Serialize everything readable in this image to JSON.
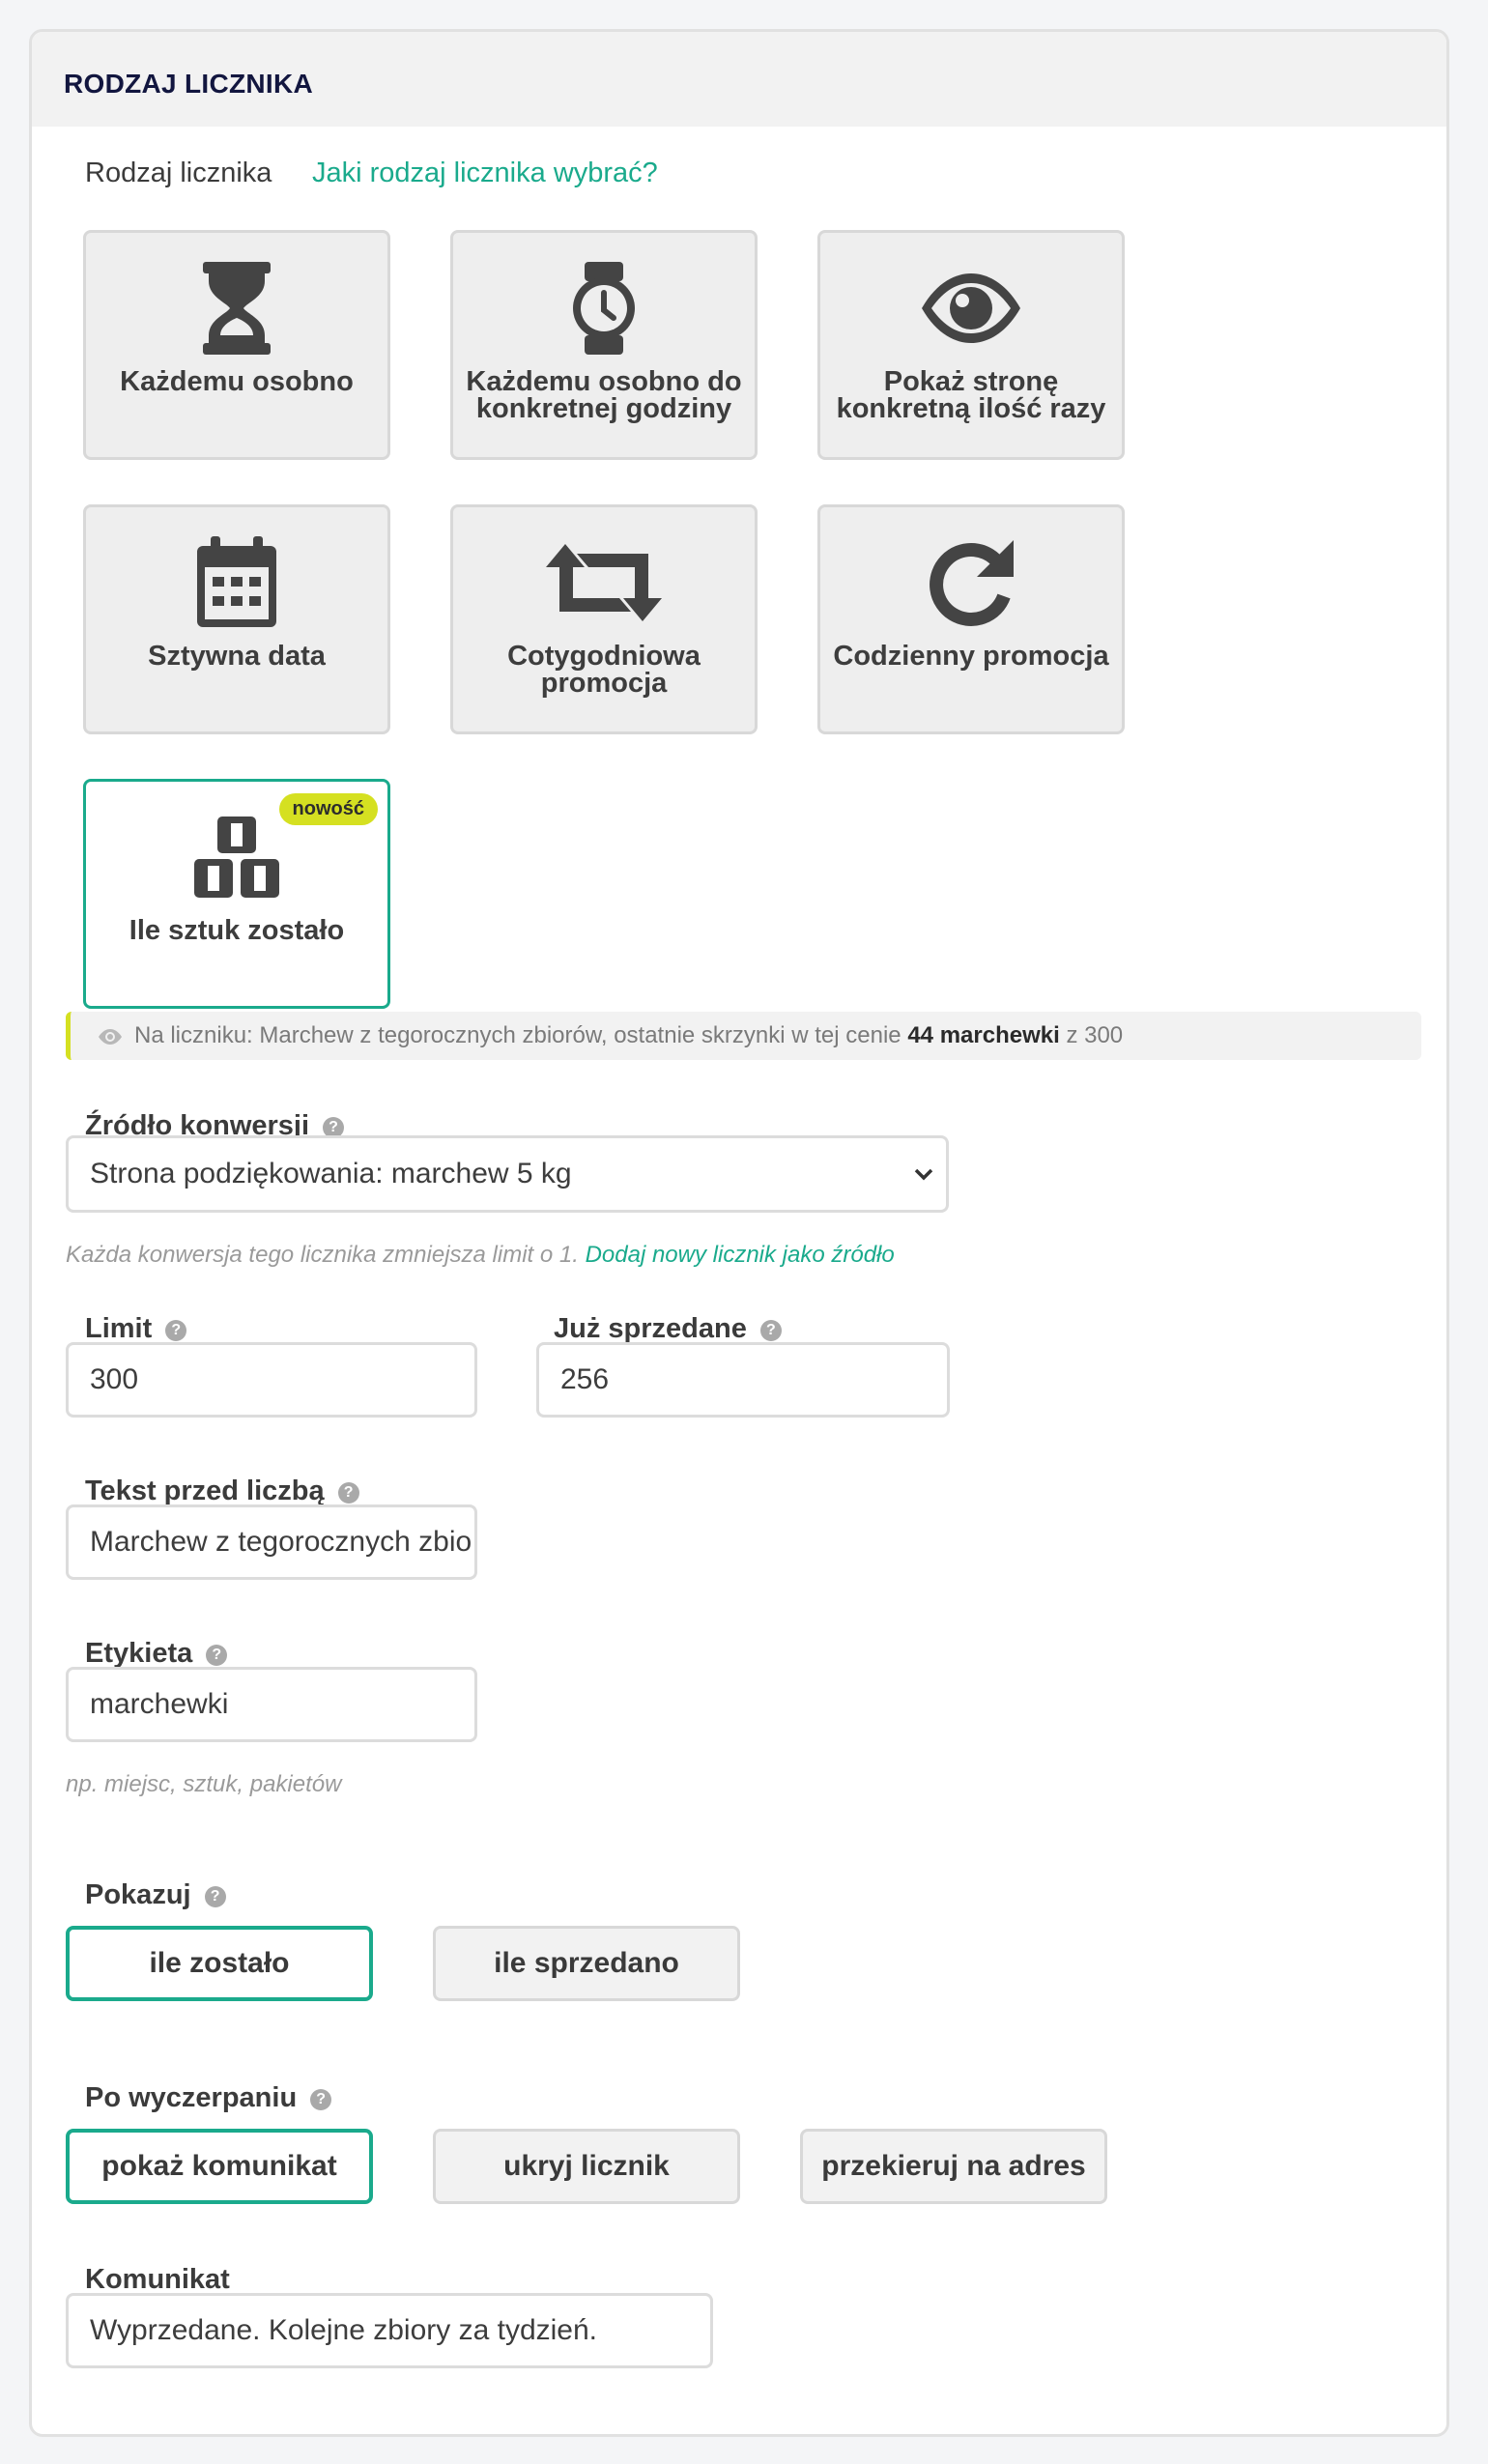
{
  "panel": {
    "title": "RODZAJ LICZNIKA"
  },
  "counter_type": {
    "label": "Rodzaj licznika",
    "help_link": "Jaki rodzaj licznika wybrać?",
    "tiles": [
      {
        "label": "Każdemu osobno",
        "icon": "hourglass-icon"
      },
      {
        "label": "Każdemu osobno do konkretnej godziny",
        "icon": "watch-icon"
      },
      {
        "label": "Pokaż stronę konkretną ilość razy",
        "icon": "eye-icon"
      },
      {
        "label": "Sztywna data",
        "icon": "calendar-icon"
      },
      {
        "label": "Cotygodniowa promocja",
        "icon": "retweet-icon"
      },
      {
        "label": "Codzienny promocja",
        "icon": "redo-icon"
      },
      {
        "label": "Ile sztuk zostało",
        "icon": "boxes-icon",
        "badge": "nowość",
        "selected": true
      }
    ]
  },
  "preview": {
    "prefix": "Na liczniku: Marchew z tegorocznych zbiorów, ostatnie skrzynki w tej cenie",
    "count": "44 marchewki",
    "suffix": "z 300"
  },
  "conversion_source": {
    "label": "Źródło konwersji",
    "value": "Strona podziękowania: marchew 5 kg",
    "hint": "Każda konwersja tego licznika zmniejsza limit o 1.",
    "hint_link": "Dodaj nowy licznik jako źródło"
  },
  "limit": {
    "label": "Limit",
    "value": "300"
  },
  "sold": {
    "label": "Już sprzedane",
    "value": "256"
  },
  "text_before": {
    "label": "Tekst przed liczbą",
    "value": "Marchew z tegorocznych zbio"
  },
  "etykieta": {
    "label": "Etykieta",
    "value": "marchewki",
    "hint": "np. miejsc, sztuk, pakietów"
  },
  "show": {
    "label": "Pokazuj",
    "options": [
      "ile zostało",
      "ile sprzedano"
    ],
    "selected": "ile zostało"
  },
  "after_exhausted": {
    "label": "Po wyczerpaniu",
    "options": [
      "pokaż komunikat",
      "ukryj licznik",
      "przekieruj na adres"
    ],
    "selected": "pokaż komunikat"
  },
  "message": {
    "label": "Komunikat",
    "value": "Wyprzedane. Kolejne zbiory za tydzień."
  },
  "colors": {
    "accent": "#1aaa8c",
    "badge": "#d5e021",
    "title": "#12163f"
  }
}
